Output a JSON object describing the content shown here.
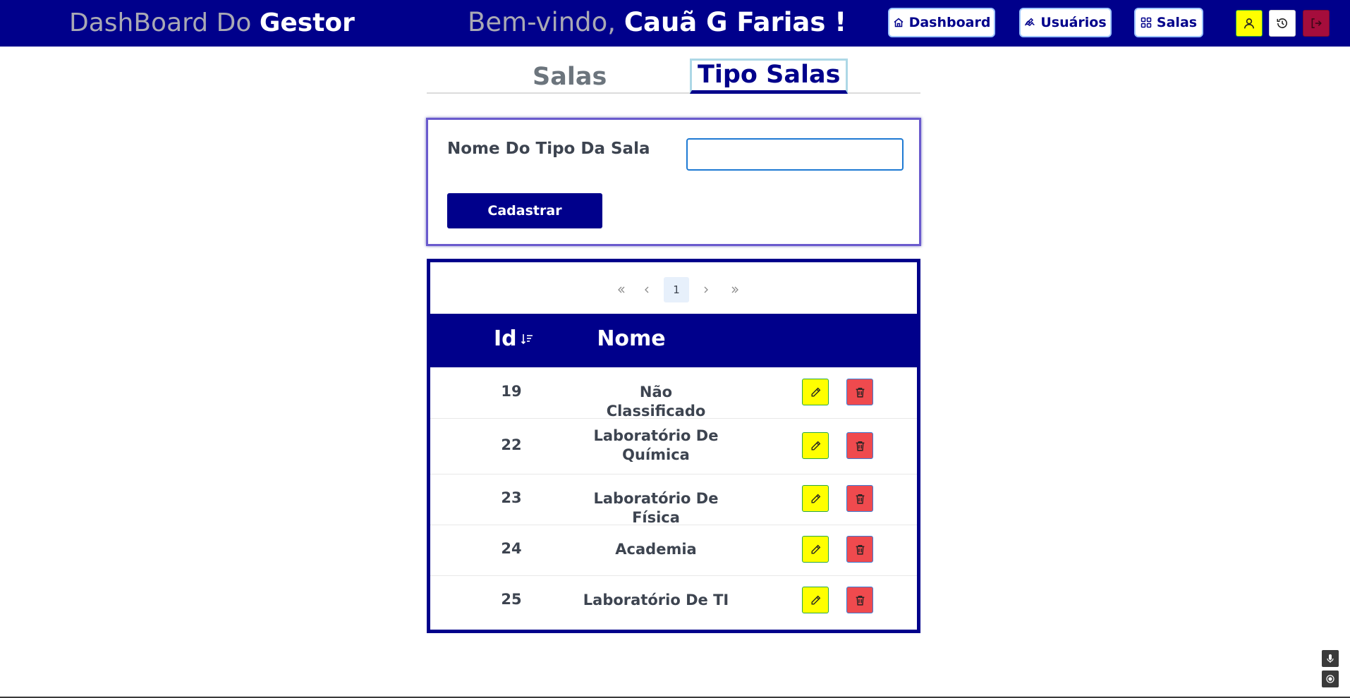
{
  "header": {
    "brand_prefix": "DashBoard Do",
    "brand_strong": "Gestor",
    "welcome_prefix": "Bem-vindo,",
    "welcome_name": "Cauã G Farias !",
    "nav": [
      {
        "label": "Dashboard",
        "icon": "home-icon"
      },
      {
        "label": "Usuários",
        "icon": "signature-icon"
      },
      {
        "label": "Salas",
        "icon": "grid-icon"
      }
    ],
    "profile_icon": "user-icon",
    "history_icon": "history-icon",
    "logout_icon": "logout-icon",
    "colors": {
      "bar": "#00008b",
      "profile_bg": "#ffff00",
      "logout_bg": "#a50d3c"
    }
  },
  "tabs": {
    "items": [
      {
        "label": "Salas",
        "active": false
      },
      {
        "label": "Tipo Salas",
        "active": true
      }
    ]
  },
  "form": {
    "label": "Nome Do Tipo Da Sala",
    "value": "",
    "placeholder": "",
    "submit_label": "Cadastrar"
  },
  "table": {
    "pagination": {
      "current_page": "1",
      "first_icon": "chevrons-left-icon",
      "prev_icon": "chevron-left-icon",
      "next_icon": "chevron-right-icon",
      "last_icon": "chevrons-right-icon"
    },
    "columns": {
      "id": "Id",
      "nome": "Nome",
      "sort_icon": "sort-desc-icon"
    },
    "rows": [
      {
        "id": "19",
        "nome": "Não Classificado"
      },
      {
        "id": "22",
        "nome": "Laboratório De Química"
      },
      {
        "id": "23",
        "nome": "Laboratório De Física"
      },
      {
        "id": "24",
        "nome": "Academia"
      },
      {
        "id": "25",
        "nome": "Laboratório De TI"
      }
    ],
    "row_actions": {
      "edit_icon": "pencil-icon",
      "delete_icon": "trash-icon"
    },
    "colors": {
      "header": "#00008b",
      "edit": "#ffff00",
      "delete": "#ef4a4e"
    }
  },
  "floating": {
    "mic_icon": "microphone-icon",
    "target_icon": "target-icon"
  }
}
